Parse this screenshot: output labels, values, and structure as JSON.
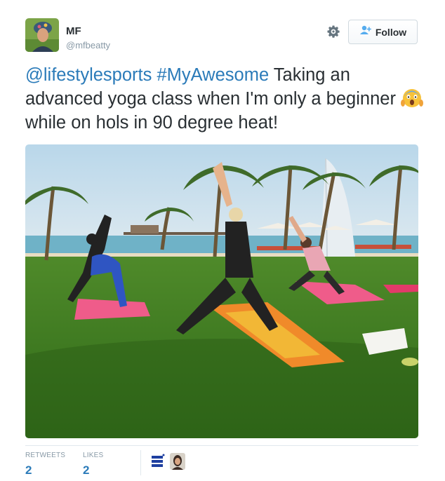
{
  "author": {
    "name": "MF",
    "handle": "@mfbeatty"
  },
  "follow_button": {
    "label": "Follow"
  },
  "tweet": {
    "mention": "@lifestylesports",
    "hashtag": "#MyAwesome",
    "text_part1": " Taking an advanced yoga class when I'm only a beginner ",
    "text_part2": "while on hols in 90 degree heat!"
  },
  "stats": {
    "retweets_label": "RETWEETS",
    "retweets_count": "2",
    "likes_label": "LIKES",
    "likes_count": "2"
  },
  "icons": {
    "settings": "gear-icon",
    "follow": "add-user-icon",
    "emoji": "screaming-face-emoji"
  },
  "colors": {
    "link": "#2b7bb9",
    "muted": "#8899a6",
    "text": "#292f33",
    "border": "#e1e8ed"
  }
}
